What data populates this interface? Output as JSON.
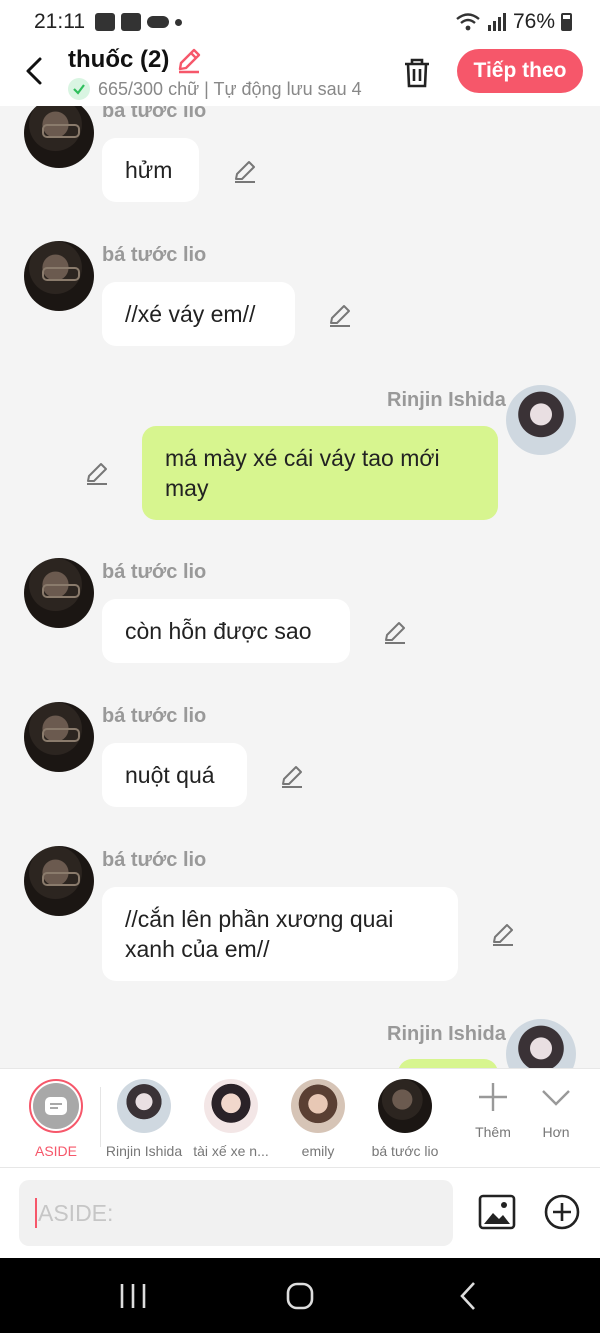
{
  "status_bar": {
    "time": "21:11",
    "battery": "76%"
  },
  "header": {
    "title": "thuốc (2)",
    "meta": "665/300 chữ | Tự động lưu sau 4",
    "next_label": "Tiếp theo"
  },
  "messages": [
    {
      "sender": "bá tước lio",
      "text": "hửm"
    },
    {
      "sender": "bá tước lio",
      "text": "//xé váy em//"
    },
    {
      "sender": "Rinjin Ishida",
      "text": "má mày xé cái váy tao mới may"
    },
    {
      "sender": "bá tước lio",
      "text": "còn hỗn được sao"
    },
    {
      "sender": "bá tước lio",
      "text": "nuột quá"
    },
    {
      "sender": "bá tước lio",
      "text": "//cắn lên phần xương quai xanh của em//"
    },
    {
      "sender": "Rinjin Ishida",
      "text": ""
    }
  ],
  "characters": [
    {
      "name": "ASIDE"
    },
    {
      "name": "Rinjin Ishida"
    },
    {
      "name": "tài xế xe n..."
    },
    {
      "name": "emily"
    },
    {
      "name": "bá tước lio"
    }
  ],
  "tools": {
    "add_label": "Thêm",
    "more_label": "Hơn"
  },
  "input": {
    "placeholder": "ASIDE:",
    "value": ""
  },
  "colors": {
    "accent": "#f6576a",
    "bubble_user": "#d7f58f",
    "bubble_other": "#ffffff"
  }
}
